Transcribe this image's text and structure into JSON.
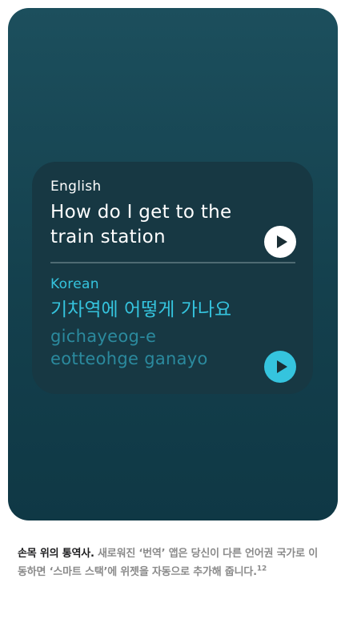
{
  "translator": {
    "source_language": "English",
    "source_text": "How do I get to the train station",
    "target_language": "Korean",
    "target_text": "기차역에 어떻게 가나요",
    "romanization": "gichayeog-e eotteohge ganayo"
  },
  "colors": {
    "background_top": "#1c4f5d",
    "background_bottom": "#0f3845",
    "card": "#173843",
    "accent": "#35c4de",
    "romanization": "#2b8a9e"
  },
  "caption": {
    "lead": "손목 위의 통역사.",
    "body": "새로워진 ‘번역’ 앱은 당신이 다른 언어권 국가로 이동하면 ‘스마트 스택’에 위젯을 자동으로 추가해 줍니다.",
    "footnote": "12"
  }
}
